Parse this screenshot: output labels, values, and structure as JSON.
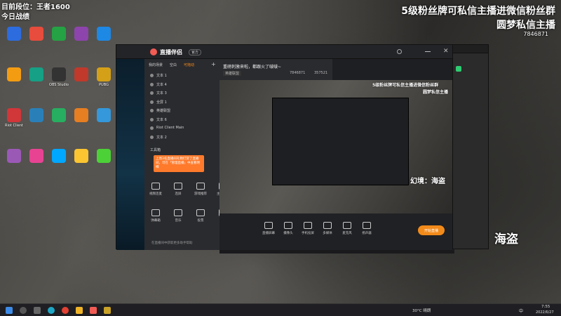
{
  "overlay": {
    "top_left_line1": "目前段位：王者1600",
    "top_left_line2": "今日战绩",
    "top_right_line1": "5级粉丝牌可私信主播进微信粉丝群",
    "top_right_line2": "圆梦私信主播",
    "top_right_id": "7846871",
    "bottom_right": "幻境：海盗"
  },
  "desktop_icons": [
    {
      "label": "",
      "color": "#2d6cdf"
    },
    {
      "label": "",
      "color": "#e74c3c"
    },
    {
      "label": "",
      "color": "#25a244"
    },
    {
      "label": "",
      "color": "#8e44ad"
    },
    {
      "label": "",
      "color": "#1e88e5"
    },
    {
      "label": "",
      "color": "#f39c12"
    },
    {
      "label": "",
      "color": "#16a085"
    },
    {
      "label": "OBS Studio",
      "color": "#333333"
    },
    {
      "label": "",
      "color": "#c0392b"
    },
    {
      "label": "PUBG",
      "color": "#d4a017"
    },
    {
      "label": "Riot Client",
      "color": "#d13639"
    },
    {
      "label": "",
      "color": "#2980b9"
    },
    {
      "label": "",
      "color": "#27ae60"
    },
    {
      "label": "",
      "color": "#e67e22"
    },
    {
      "label": "",
      "color": "#3498db"
    },
    {
      "label": "",
      "color": "#9b59b6"
    },
    {
      "label": "",
      "color": "#e84393"
    },
    {
      "label": "",
      "color": "#00a8ff"
    },
    {
      "label": "",
      "color": "#fbc531"
    },
    {
      "label": "",
      "color": "#4cd137"
    }
  ],
  "app": {
    "title": "直播伴侣",
    "badge": "官方",
    "tabs": [
      "我的场景",
      "空白",
      "可拖动"
    ],
    "stream_title": "重磅刺激来啦，都跟火了啵啵~",
    "category": "英雄联盟",
    "room_id": "7846871",
    "viewers": "357521",
    "layers": [
      "文本 1",
      "文本 4",
      "文本 3",
      "全屏 1",
      "英雄联盟",
      "文本 6",
      "Riot Client Main",
      "文本 2"
    ],
    "toolbox_label": "工具箱",
    "tooltip": "上周3名直播间礼物打赏了直播间，可在「管理直播」中查看明细",
    "tools_left": [
      "视频连麦",
      "连屏",
      "游戏推荐",
      "主播任务",
      "弹幕箱",
      "音乐",
      "投票",
      "福利"
    ],
    "bottom_tools": [
      "直播屏幕",
      "摄像头",
      "手机投屏",
      "多媒体",
      "麦克风",
      "扬声器"
    ],
    "start_label": "开始直播",
    "footer": "在直播间中获取更多助手帮助"
  },
  "preview": {
    "overlay_line1": "5级粉丝牌可私信主播进微信粉丝群",
    "overlay_line2": "圆梦私信主播",
    "bottom_label": "幻境：海盗"
  },
  "taskbar": {
    "weather": "30°C 晴朗",
    "time": "7:55",
    "date": "2022/6/27",
    "lang": "中"
  }
}
